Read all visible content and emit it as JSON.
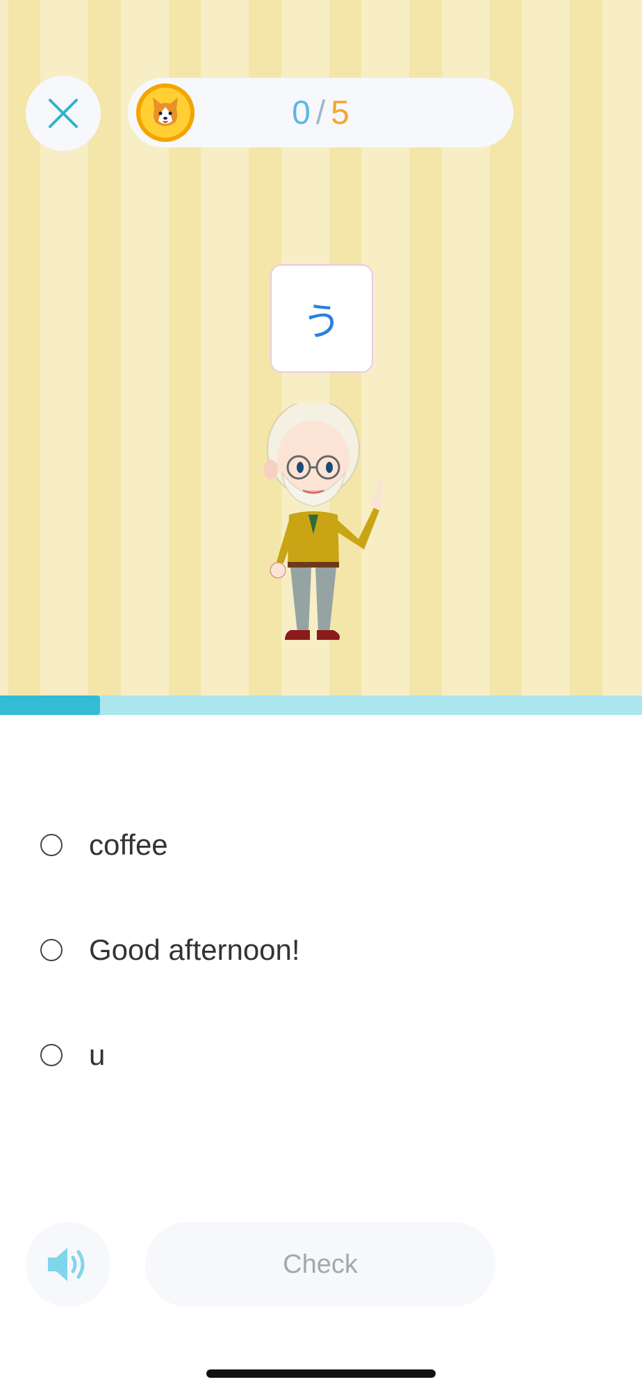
{
  "header": {
    "counter_current": "0",
    "counter_separator": "/",
    "counter_total": "5",
    "close_icon": "close-icon",
    "coin_icon": "corgi-coin-icon"
  },
  "prompt": {
    "kana": "う"
  },
  "progress": {
    "fraction": 0.2,
    "fill_color": "#33bcd6",
    "track_color": "#abe6ee"
  },
  "options": [
    {
      "label": "coffee"
    },
    {
      "label": "Good afternoon!"
    },
    {
      "label": "u"
    }
  ],
  "footer": {
    "speaker_icon": "speaker-icon",
    "check_label": "Check"
  },
  "colors": {
    "accent": "#33bcd6",
    "coin": "#ffcf33",
    "total": "#f3a82a",
    "current": "#5bb7e6"
  }
}
